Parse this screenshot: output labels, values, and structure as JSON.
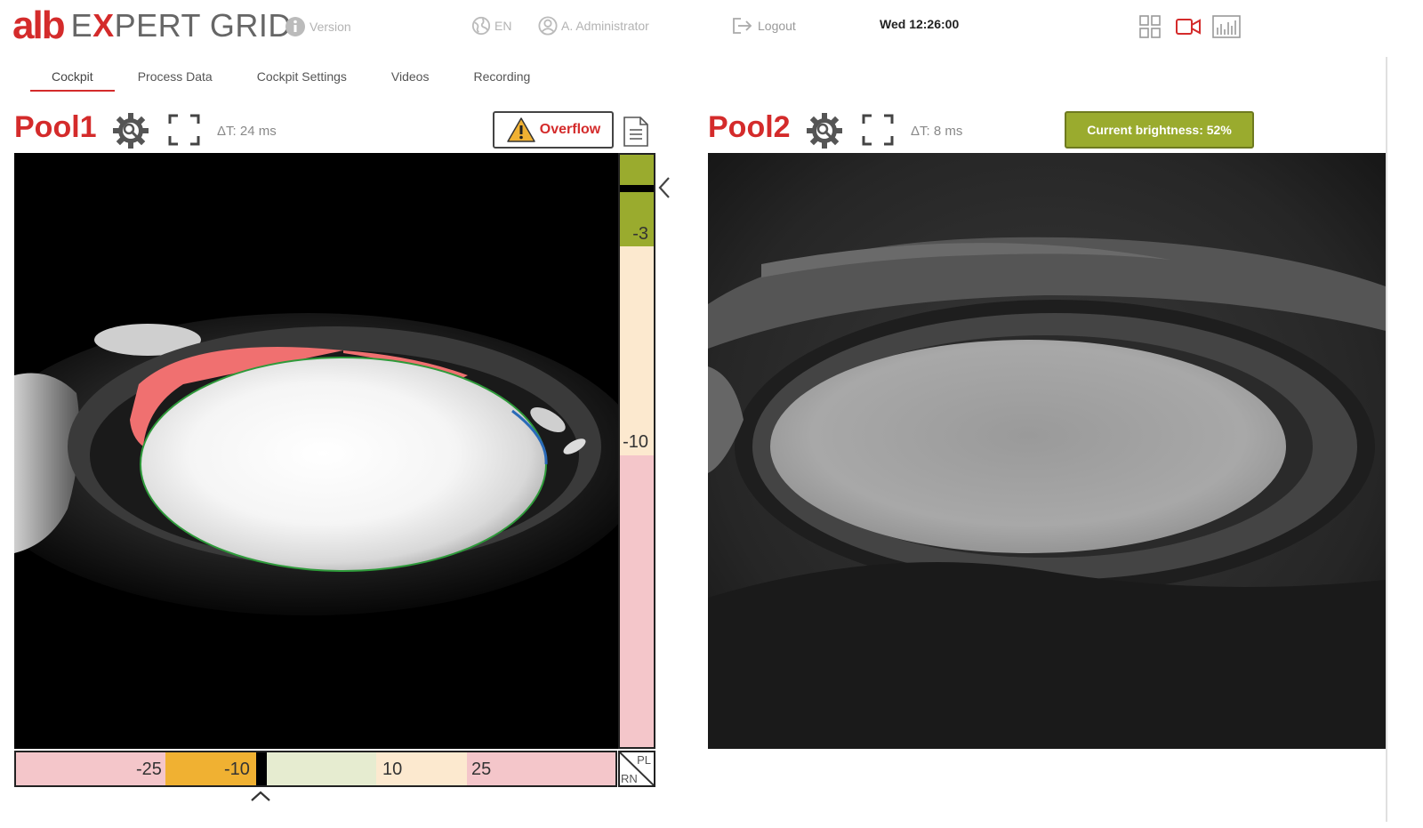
{
  "header": {
    "logo_brand": "alb",
    "logo_product_pre": "E",
    "logo_product_x": "X",
    "logo_product_post": "PERT GRID",
    "version_label": "Version",
    "language_label": "EN",
    "user_label": "A. Administrator",
    "logout_label": "Logout",
    "clock": "Wed 12:26:00",
    "icons": [
      "grid-layout-icon",
      "video-camera-icon",
      "chart-icon"
    ]
  },
  "tabs": [
    {
      "label": "Cockpit",
      "active": true
    },
    {
      "label": "Process Data",
      "active": false
    },
    {
      "label": "Cockpit Settings",
      "active": false
    },
    {
      "label": "Videos",
      "active": false
    },
    {
      "label": "Recording",
      "active": false
    }
  ],
  "pool1": {
    "title": "Pool1",
    "delta": "ΔT: 24 ms",
    "status_label": "Overflow",
    "vgauge_labels": [
      "-3",
      "-10"
    ],
    "hgauge_labels": [
      "-25",
      "-10",
      "10",
      "25"
    ],
    "corner_top": "PL",
    "corner_bottom": "RN"
  },
  "pool2": {
    "title": "Pool2",
    "delta": "ΔT: 8 ms",
    "brightness_label": "Current brightness: 52%",
    "brightness": 52
  },
  "colors": {
    "brand_red": "#d42b2b",
    "ok_green": "#9aab2e",
    "warn_orange": "#f0b132",
    "zone_pink": "#f4c6ca",
    "zone_cream": "#fce9cf",
    "zone_lightgreen": "#e6ecd0"
  }
}
